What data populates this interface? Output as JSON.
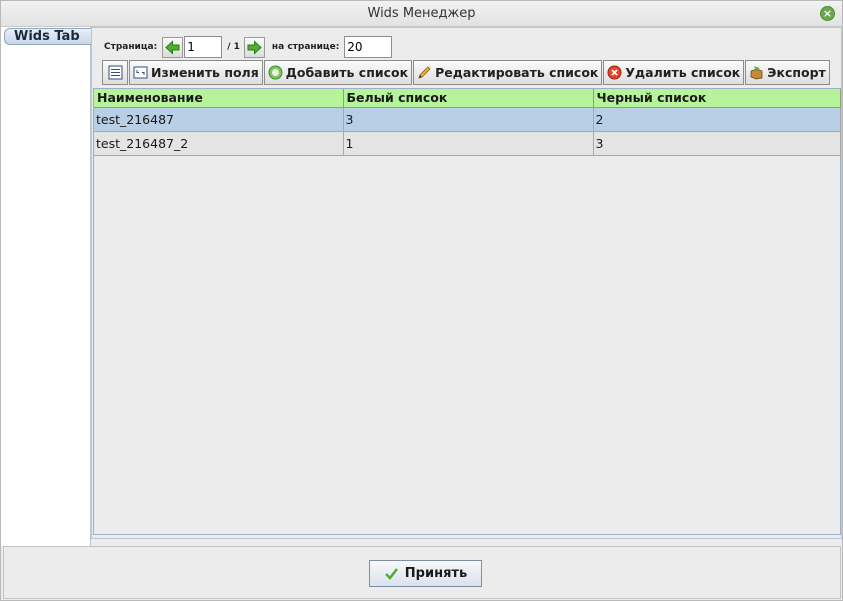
{
  "window": {
    "title": "Wids Менеджер"
  },
  "sidebar": {
    "tab_label": "Wids Tab"
  },
  "pager": {
    "page_label": "Страница:",
    "page_value": "1",
    "page_total": "/ 1",
    "per_page_label": "на странице:",
    "per_page_value": "20"
  },
  "toolbar": {
    "edit_fields": "Изменить поля",
    "add_list": "Добавить список",
    "edit_list": "Редактировать список",
    "delete_list": "Удалить список",
    "export": "Экспорт"
  },
  "table": {
    "columns": [
      "Наименование",
      "Белый список",
      "Черный список"
    ],
    "rows": [
      [
        "test_216487",
        "3",
        "2"
      ],
      [
        "test_216487_2",
        "1",
        "3"
      ]
    ]
  },
  "footer": {
    "accept": "Принять"
  },
  "colors": {
    "header_bg": "#b6f39a",
    "selected_row": "#b8cfe5",
    "close_green": "#6aa84f"
  }
}
